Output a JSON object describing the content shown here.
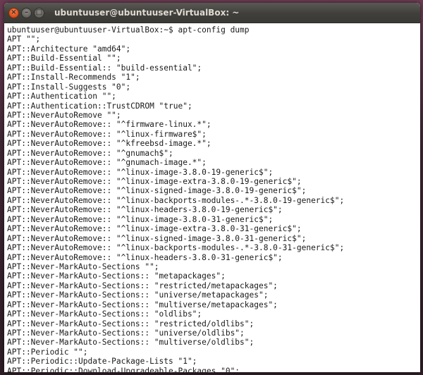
{
  "window": {
    "title": "ubuntuuser@ubuntuuser-VirtualBox: ~",
    "buttons": {
      "close_glyph": "×",
      "minimize_glyph": "–",
      "maximize_glyph": "□"
    }
  },
  "terminal": {
    "lines": [
      "ubuntuuser@ubuntuuser-VirtualBox:~$ apt-config dump",
      "APT \"\";",
      "APT::Architecture \"amd64\";",
      "APT::Build-Essential \"\";",
      "APT::Build-Essential:: \"build-essential\";",
      "APT::Install-Recommends \"1\";",
      "APT::Install-Suggests \"0\";",
      "APT::Authentication \"\";",
      "APT::Authentication::TrustCDROM \"true\";",
      "APT::NeverAutoRemove \"\";",
      "APT::NeverAutoRemove:: \"^firmware-linux.*\";",
      "APT::NeverAutoRemove:: \"^linux-firmware$\";",
      "APT::NeverAutoRemove:: \"^kfreebsd-image.*\";",
      "APT::NeverAutoRemove:: \"^gnumach$\";",
      "APT::NeverAutoRemove:: \"^gnumach-image.*\";",
      "APT::NeverAutoRemove:: \"^linux-image-3.8.0-19-generic$\";",
      "APT::NeverAutoRemove:: \"^linux-image-extra-3.8.0-19-generic$\";",
      "APT::NeverAutoRemove:: \"^linux-signed-image-3.8.0-19-generic$\";",
      "APT::NeverAutoRemove:: \"^linux-backports-modules-.*-3.8.0-19-generic$\";",
      "APT::NeverAutoRemove:: \"^linux-headers-3.8.0-19-generic$\";",
      "APT::NeverAutoRemove:: \"^linux-image-3.8.0-31-generic$\";",
      "APT::NeverAutoRemove:: \"^linux-image-extra-3.8.0-31-generic$\";",
      "APT::NeverAutoRemove:: \"^linux-signed-image-3.8.0-31-generic$\";",
      "APT::NeverAutoRemove:: \"^linux-backports-modules-.*-3.8.0-31-generic$\";",
      "APT::NeverAutoRemove:: \"^linux-headers-3.8.0-31-generic$\";",
      "APT::Never-MarkAuto-Sections \"\";",
      "APT::Never-MarkAuto-Sections:: \"metapackages\";",
      "APT::Never-MarkAuto-Sections:: \"restricted/metapackages\";",
      "APT::Never-MarkAuto-Sections:: \"universe/metapackages\";",
      "APT::Never-MarkAuto-Sections:: \"multiverse/metapackages\";",
      "APT::Never-MarkAuto-Sections:: \"oldlibs\";",
      "APT::Never-MarkAuto-Sections:: \"restricted/oldlibs\";",
      "APT::Never-MarkAuto-Sections:: \"universe/oldlibs\";",
      "APT::Never-MarkAuto-Sections:: \"multiverse/oldlibs\";",
      "APT::Periodic \"\";",
      "APT::Periodic::Update-Package-Lists \"1\";",
      "APT::Periodic::Download-Upgradeable-Packages \"0\";"
    ]
  }
}
